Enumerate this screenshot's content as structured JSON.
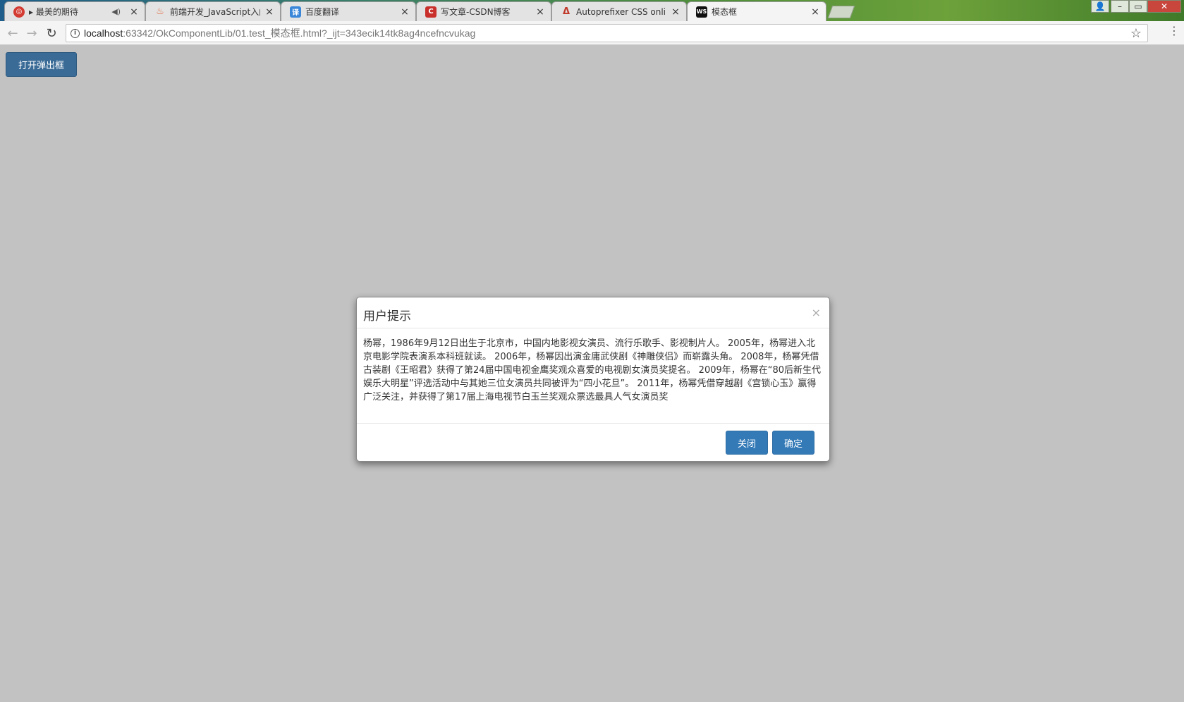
{
  "browser": {
    "tabs": [
      {
        "title": "▸ 最美的期待",
        "icon": "netease-music-icon",
        "color": "#d33a31",
        "muted": true
      },
      {
        "title": "前端开发_JavaScript入门",
        "icon": "flame-icon",
        "color": "#e0663a",
        "muted": false
      },
      {
        "title": "百度翻译",
        "icon": "baidu-translate-icon",
        "color": "#3a86d9",
        "muted": false
      },
      {
        "title": "写文章-CSDN博客",
        "icon": "csdn-icon",
        "color": "#c9302c",
        "muted": false
      },
      {
        "title": "Autoprefixer CSS online",
        "icon": "autoprefixer-icon",
        "color": "#c0392b",
        "muted": false
      },
      {
        "title": "模态框",
        "icon": "webstorm-icon",
        "color": "#111111",
        "muted": false,
        "active": true
      }
    ],
    "favicon_glyphs": {
      "netease": "◎",
      "flame": "♨",
      "translate": "译",
      "csdn": "C",
      "autoprefixer": "ᐃ",
      "webstorm": "WS"
    },
    "mute_glyph": "◀)",
    "close_glyph": "×",
    "url_host": "localhost",
    "url_rest": ":63342/OkComponentLib/01.test_模态框.html?_ijt=343ecik14tk8ag4ncefncvukag",
    "back_glyph": "←",
    "forward_glyph": "→",
    "reload_glyph": "↻",
    "info_glyph": "i",
    "star_glyph": "☆",
    "menu_glyph": "⋮",
    "window_controls": {
      "user": "👤",
      "minimize": "–",
      "maximize": "▭",
      "close": "✕"
    }
  },
  "page": {
    "open_button": "打开弹出框"
  },
  "modal": {
    "title": "用户提示",
    "close_glyph": "×",
    "body": "杨幂，1986年9月12日出生于北京市，中国内地影视女演员、流行乐歌手、影视制片人。 2005年，杨幂进入北京电影学院表演系本科班就读。 2006年，杨幂因出演金庸武侠剧《神雕侠侣》而崭露头角。 2008年，杨幂凭借古装剧《王昭君》获得了第24届中国电视金鹰奖观众喜爱的电视剧女演员奖提名。 2009年，杨幂在“80后新生代娱乐大明星”评选活动中与其她三位女演员共同被评为“四小花旦”。 2011年，杨幂凭借穿越剧《宫锁心玉》赢得广泛关注，并获得了第17届上海电视节白玉兰奖观众票选最具人气女演员奖",
    "close_button": "关闭",
    "confirm_button": "确定"
  },
  "colors": {
    "page_overlay": "#c2c2c2",
    "primary": "#337ab7",
    "open_button": "#3a6b96"
  }
}
